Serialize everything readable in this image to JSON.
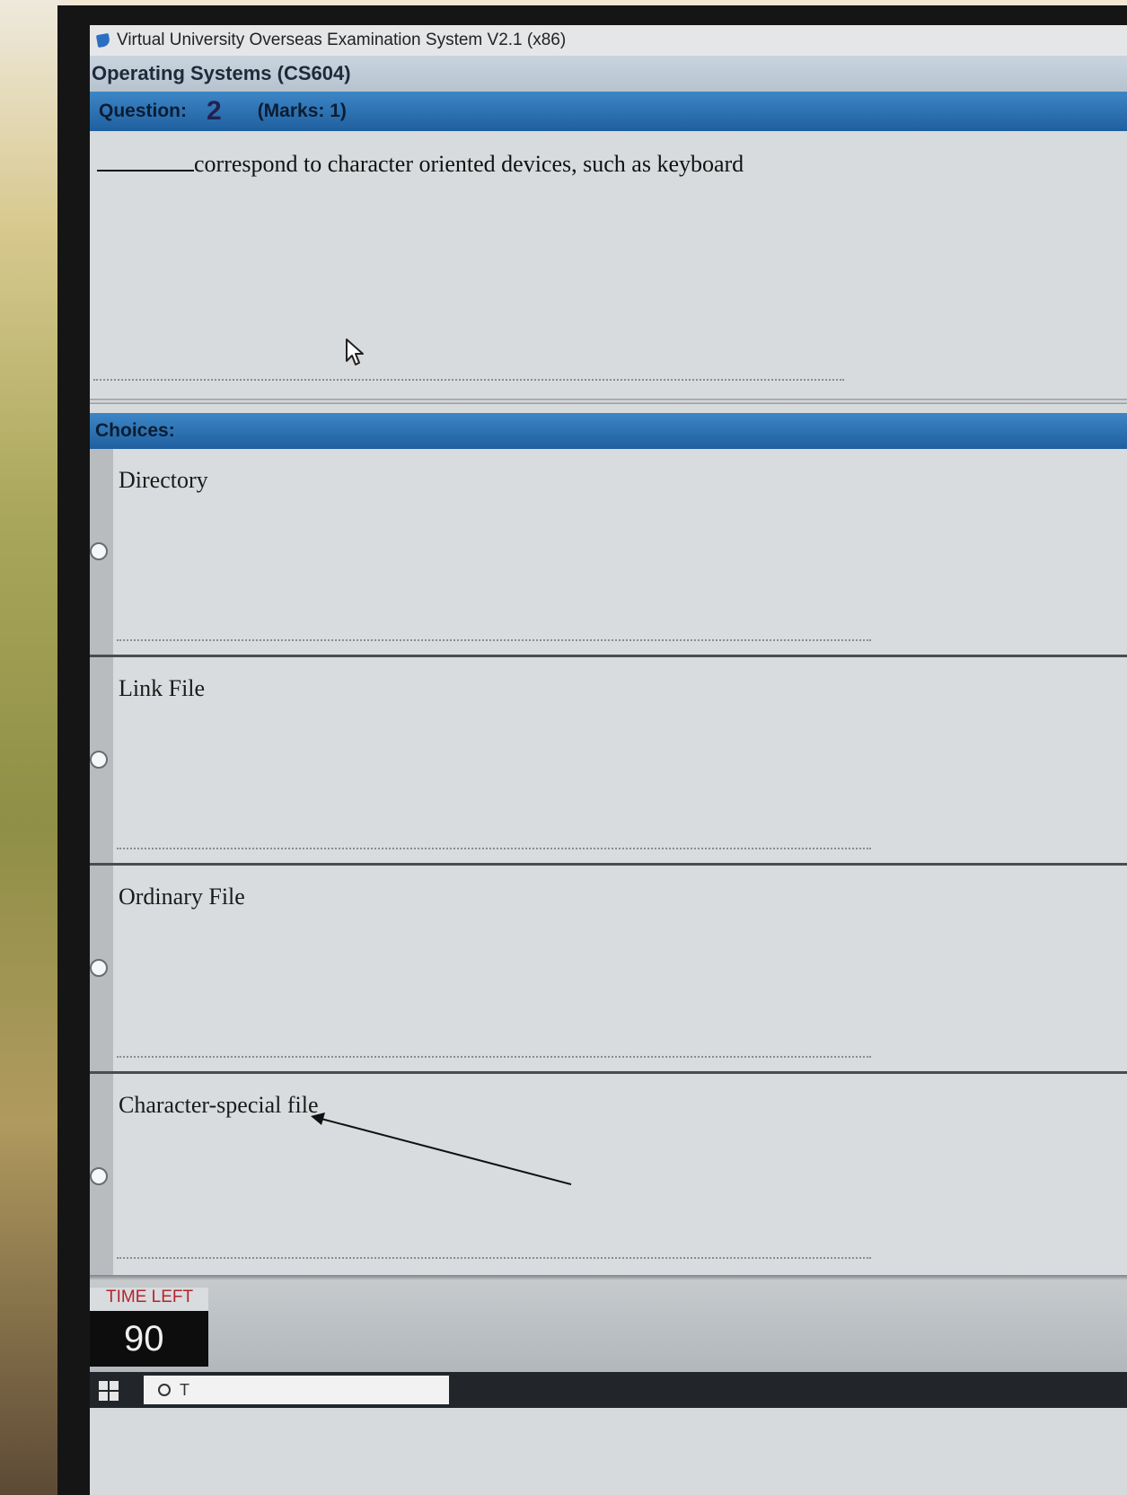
{
  "window": {
    "title": "Virtual University Overseas Examination System  V2.1 (x86)"
  },
  "course": {
    "title": "Operating Systems  (CS604)"
  },
  "question": {
    "label": "Question:",
    "number": "2",
    "marks": "(Marks: 1)",
    "text": "correspond to character oriented devices, such as keyboard"
  },
  "choices": {
    "heading": "Choices:",
    "items": [
      {
        "label": "Directory",
        "selected": false
      },
      {
        "label": "Link File",
        "selected": false
      },
      {
        "label": "Ordinary File",
        "selected": false
      },
      {
        "label": "Character-special file",
        "selected": false
      }
    ]
  },
  "timer": {
    "label": "TIME LEFT",
    "value": "90"
  },
  "taskbar": {
    "search_text": "T"
  },
  "colors": {
    "header_blue": "#2b74b8",
    "timer_label_red": "#b3242d",
    "timer_bg": "#0d0d0d"
  }
}
